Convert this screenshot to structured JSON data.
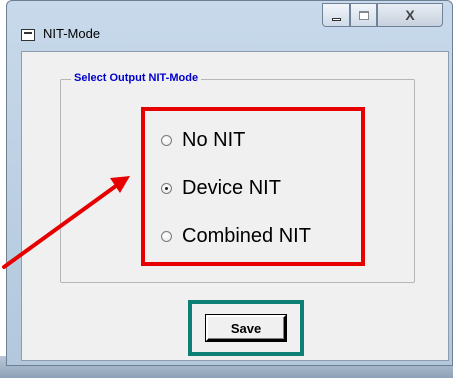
{
  "window": {
    "title": "NIT-Mode",
    "controls": {
      "minimize": "",
      "maximize": "",
      "close": "X"
    }
  },
  "group": {
    "legend": "Select Output NIT-Mode",
    "options": [
      {
        "label": "No NIT",
        "checked": false
      },
      {
        "label": "Device NIT",
        "checked": true
      },
      {
        "label": "Combined NIT",
        "checked": false
      }
    ]
  },
  "actions": {
    "save_label": "Save"
  },
  "colors": {
    "highlight_red": "#e60000",
    "highlight_teal": "#0d7f74",
    "legend_blue": "#0000cc",
    "window_frame": "#b3c8dd"
  },
  "icons": {
    "window": "window-icon",
    "minimize": "minimize-icon",
    "maximize": "maximize-icon",
    "close": "close-icon",
    "radio": "radio-icon",
    "annotation_arrow": "arrow-icon"
  }
}
